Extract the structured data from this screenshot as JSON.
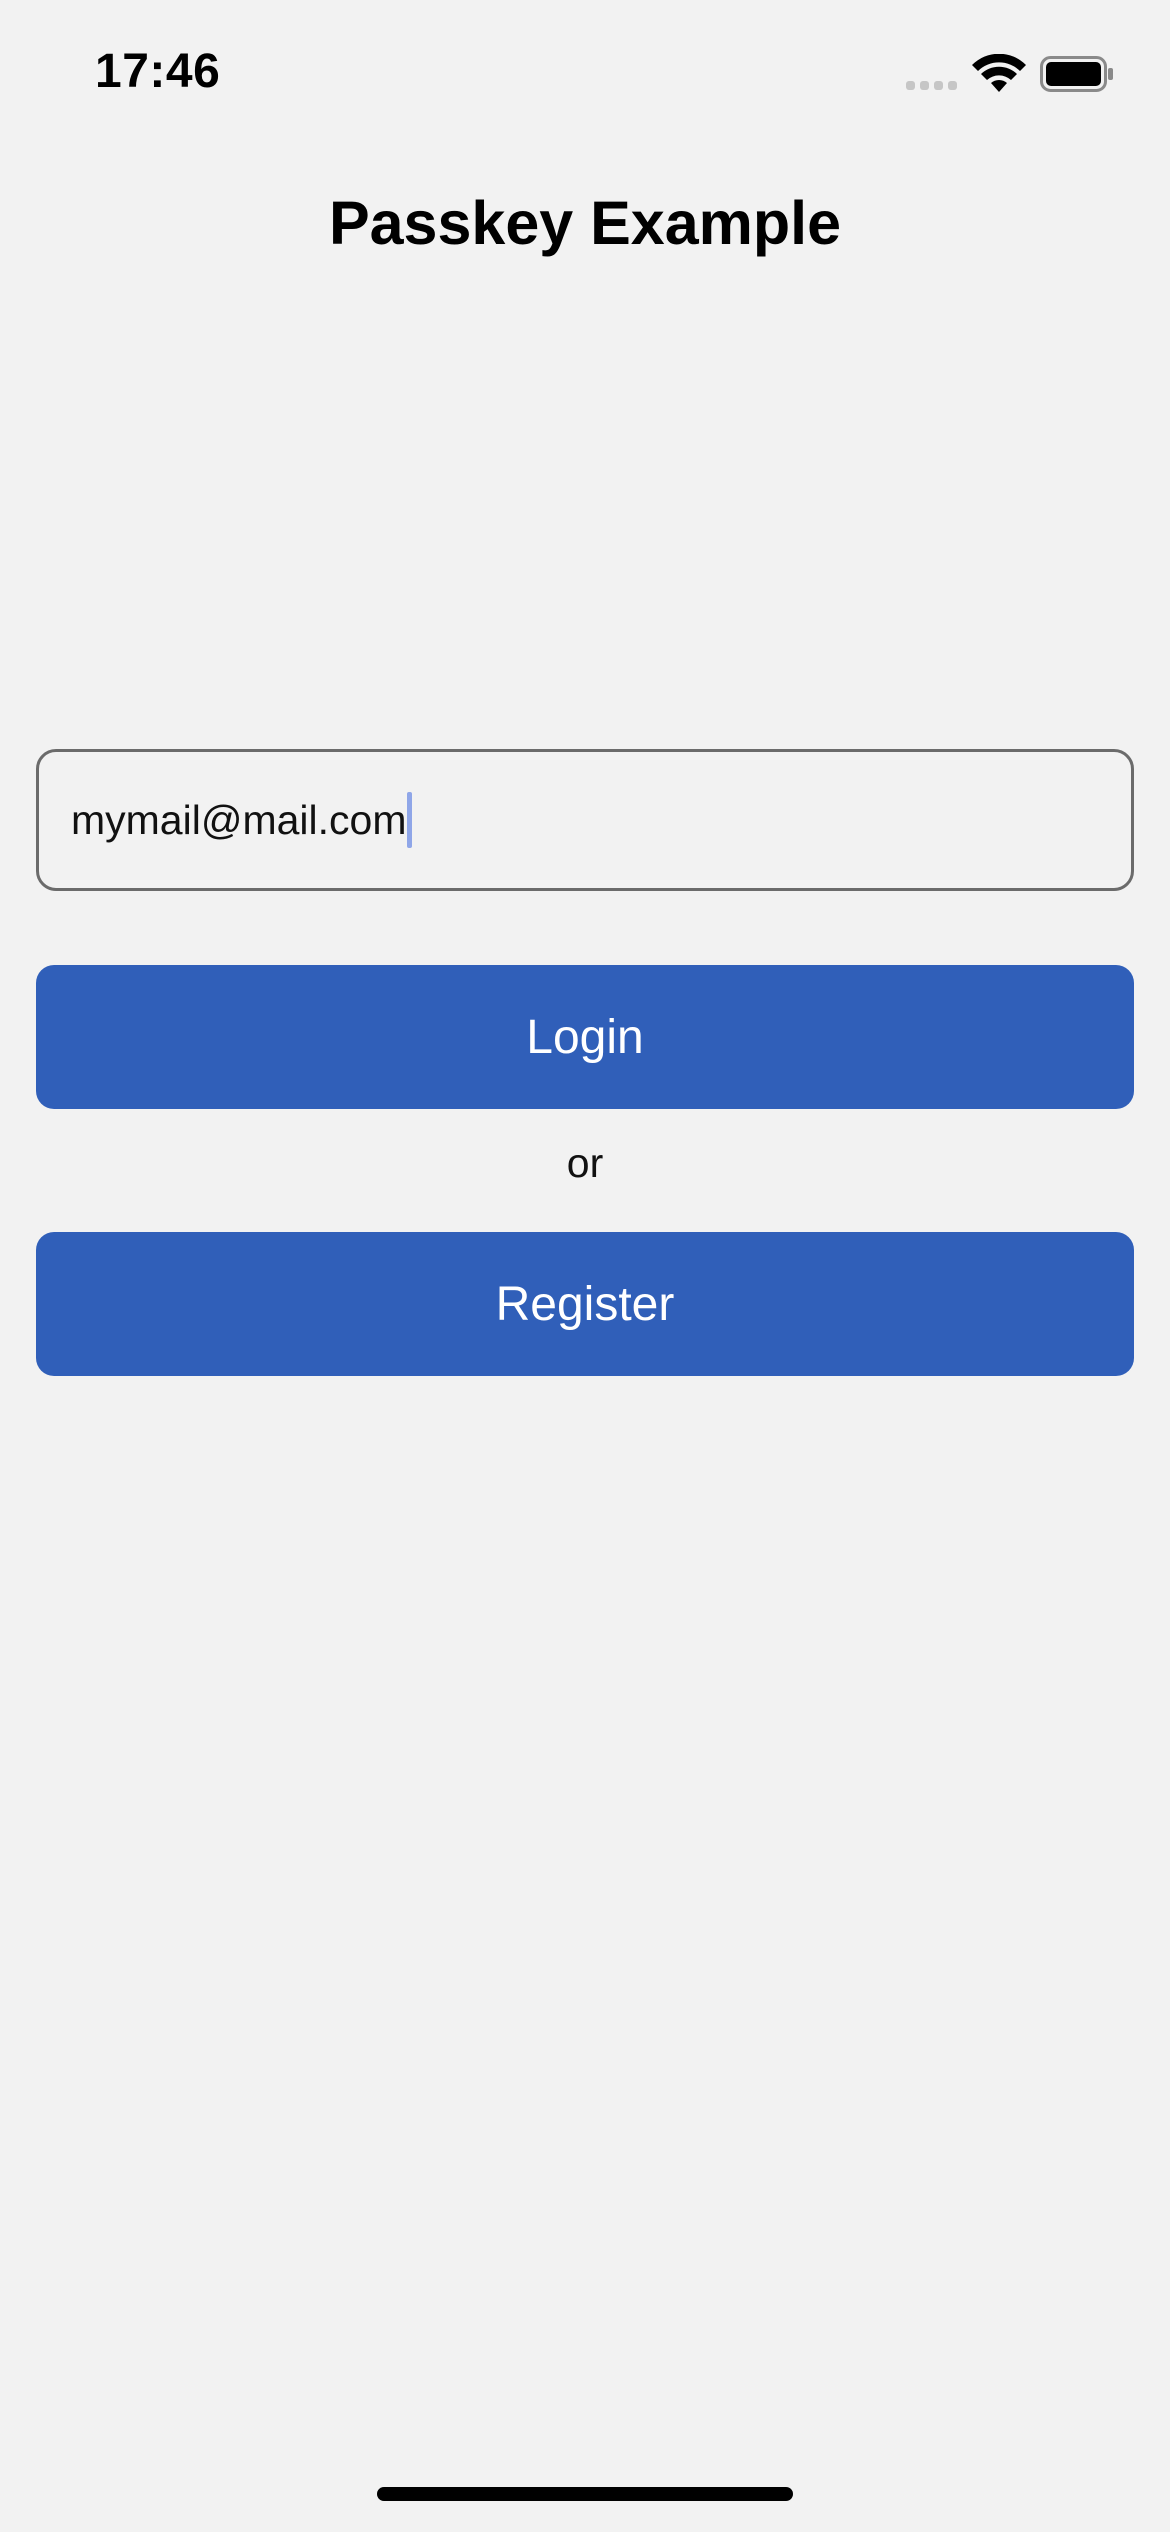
{
  "status_bar": {
    "time": "17:46",
    "icons": [
      "cellular-signal-icon",
      "wifi-icon",
      "battery-icon"
    ]
  },
  "header": {
    "title": "Passkey Example"
  },
  "form": {
    "email_value": "mymail@mail.com",
    "login_label": "Login",
    "separator_text": "or",
    "register_label": "Register"
  },
  "colors": {
    "background": "#f2f2f2",
    "button": "#305fb9",
    "button_text": "#ffffff",
    "cursor": "#8fa6e8"
  }
}
